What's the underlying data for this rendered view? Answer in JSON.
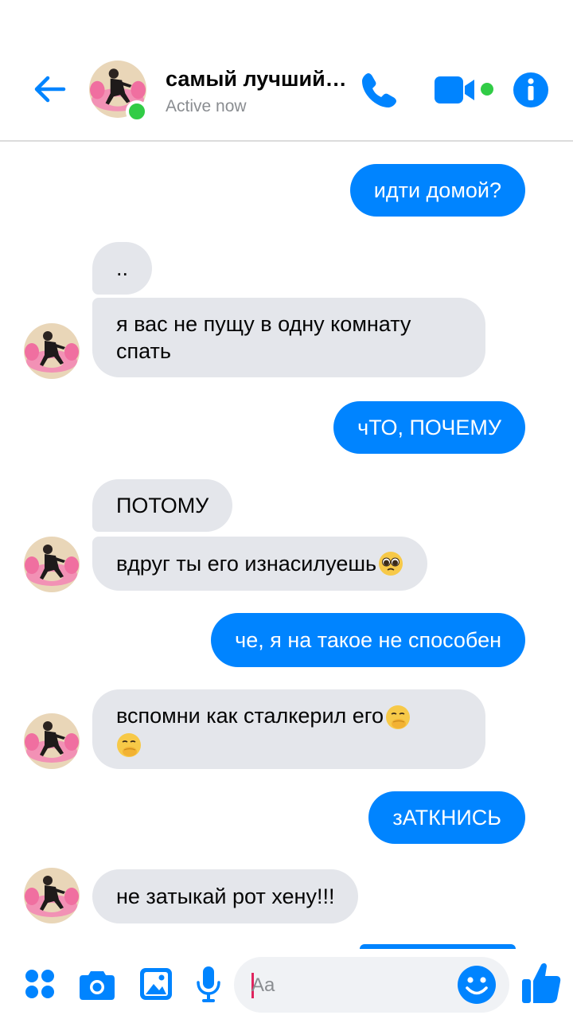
{
  "header": {
    "title": "самый лучший…",
    "status": "Active now"
  },
  "messages": [
    {
      "side": "out",
      "text": "идти домой?"
    },
    {
      "side": "in",
      "text": ".."
    },
    {
      "side": "in",
      "text": "я вас не пущу в одну комнату спать"
    },
    {
      "side": "out",
      "text": "чТО, ПОЧЕМУ"
    },
    {
      "side": "in",
      "text": "ПОТОМУ"
    },
    {
      "side": "in",
      "text": "вдруг ты его изнасилуешь",
      "emoji": "pleading-face"
    },
    {
      "side": "out",
      "text": "че, я на такое не способен"
    },
    {
      "side": "in",
      "text": "вспомни как сталкерил его",
      "emoji": "face-with-hand-over-mouth"
    },
    {
      "side": "out",
      "text": "зАТКНИСЬ"
    },
    {
      "side": "in",
      "text": "не затыкай рот хену!!!"
    }
  ],
  "composer": {
    "placeholder": "Aa"
  },
  "colors": {
    "accent": "#0084ff",
    "incoming_bubble": "#e4e6eb",
    "online": "#31cc46"
  }
}
